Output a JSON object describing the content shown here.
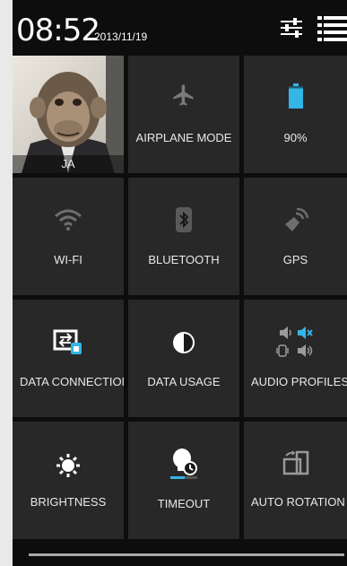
{
  "header": {
    "time": "08:52",
    "date": "2013/11/19",
    "settings_icon": "sliders-icon",
    "notifications_icon": "list-icon"
  },
  "tiles": [
    {
      "label": "JA",
      "icon": "user-avatar"
    },
    {
      "label": "AIRPLANE MODE",
      "icon": "airplane-icon"
    },
    {
      "label": "90%",
      "icon": "battery-icon"
    },
    {
      "label": "WI-FI",
      "icon": "wifi-icon"
    },
    {
      "label": "BLUETOOTH",
      "icon": "bluetooth-icon"
    },
    {
      "label": "GPS",
      "icon": "gps-icon"
    },
    {
      "label": "DATA CONNECTION",
      "icon": "data-connection-icon"
    },
    {
      "label": "DATA USAGE",
      "icon": "data-usage-icon"
    },
    {
      "label": "AUDIO PROFILES",
      "icon": "audio-profiles-icon"
    },
    {
      "label": "BRIGHTNESS",
      "icon": "brightness-icon"
    },
    {
      "label": "TIMEOUT",
      "icon": "timeout-icon"
    },
    {
      "label": "AUTO ROTATION",
      "icon": "auto-rotation-icon"
    }
  ],
  "battery_level": 0.9,
  "colors": {
    "accent": "#33b5e5",
    "tile_bg": "#282828",
    "panel_bg": "#0d0d0d"
  }
}
